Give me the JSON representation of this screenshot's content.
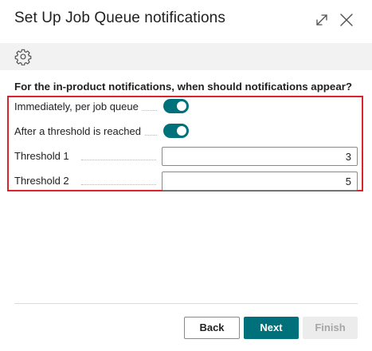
{
  "dialog": {
    "title": "Set Up Job Queue notifications",
    "expand_icon": "expand-icon",
    "close_icon": "close-icon"
  },
  "toolbar": {
    "settings_icon": "gear-icon"
  },
  "content": {
    "instruction": "For the in-product notifications, when should notifications appear?",
    "fields": [
      {
        "label": "Immediately, per job queue",
        "type": "toggle",
        "value": true
      },
      {
        "label": "After a threshold is reached",
        "type": "toggle",
        "value": true
      },
      {
        "label": "Threshold 1",
        "type": "number",
        "value": "3"
      },
      {
        "label": "Threshold 2",
        "type": "number",
        "value": "5"
      }
    ]
  },
  "footer": {
    "back_label": "Back",
    "next_label": "Next",
    "finish_label": "Finish"
  },
  "colors": {
    "accent": "#00707a",
    "highlight_border": "#d9242b",
    "toolbar_bg": "#f2f2f2"
  }
}
